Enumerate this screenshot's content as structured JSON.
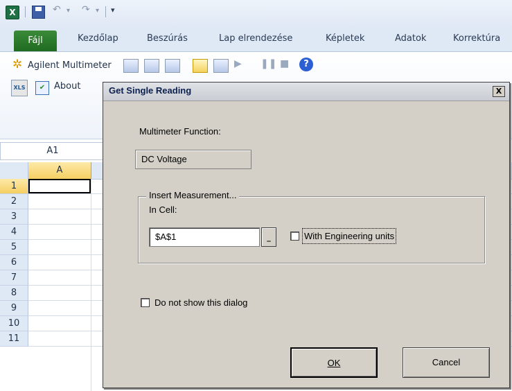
{
  "quick_access": {
    "app_icon": "excel-icon",
    "save_icon": "save-icon",
    "undo": "↶",
    "redo": "↷",
    "customize": "▾"
  },
  "ribbon_tabs": {
    "file": "Fájl",
    "tabs": [
      "Kezdőlap",
      "Beszúrás",
      "Lap elrendezése",
      "Képletek",
      "Adatok",
      "Korrektúra"
    ]
  },
  "ribbon": {
    "addin_title": "Agilent Multimeter",
    "about_label": "About",
    "help": "?"
  },
  "formula_bar": {
    "name_box": "A1"
  },
  "grid": {
    "column_header": "A",
    "rows": [
      "1",
      "2",
      "3",
      "4",
      "5",
      "6",
      "7",
      "8",
      "9",
      "10",
      "11"
    ]
  },
  "dialog": {
    "title": "Get Single Reading",
    "close": "X",
    "function_label": "Multimeter Function:",
    "function_value": "DC Voltage",
    "group_legend": "Insert Measurement...",
    "cell_label": "In Cell:",
    "cell_value": "$A$1",
    "ref_button": "_",
    "engineering_units_label": "With Engineering units",
    "do_not_show_label": "Do not show this dialog",
    "ok_label": "OK",
    "cancel_label": "Cancel"
  }
}
